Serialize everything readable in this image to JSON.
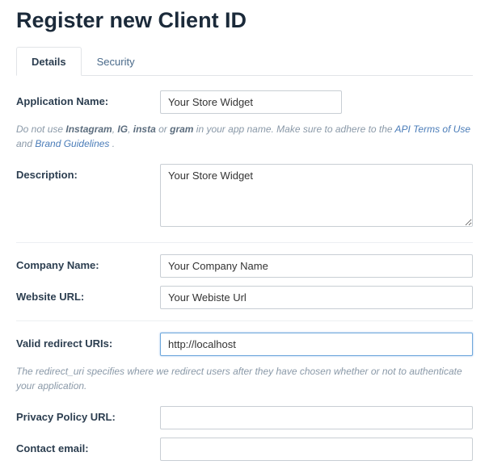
{
  "page": {
    "title": "Register new Client ID"
  },
  "tabs": {
    "details": "Details",
    "security": "Security"
  },
  "form": {
    "appName": {
      "label": "Application Name:",
      "value": "Your Store Widget"
    },
    "appNameHint": {
      "prefix": "Do not use ",
      "kw1": "Instagram",
      "sep1": ", ",
      "kw2": "IG",
      "sep2": ", ",
      "kw3": "insta",
      "sep3": " or ",
      "kw4": "gram",
      "mid": " in your app name. Make sure to adhere to the ",
      "link1": "API Terms of Use",
      "and": " and ",
      "link2": "Brand Guidelines",
      "end": " ."
    },
    "description": {
      "label": "Description:",
      "value": "Your Store Widget"
    },
    "companyName": {
      "label": "Company Name:",
      "value": "Your Company Name"
    },
    "websiteUrl": {
      "label": "Website URL:",
      "value": "Your Webiste Url"
    },
    "redirectUris": {
      "label": "Valid redirect URIs:",
      "value": "http://localhost"
    },
    "redirectHint": "The redirect_uri specifies where we redirect users after they have chosen whether or not to authenticate your application.",
    "privacyPolicy": {
      "label": "Privacy Policy URL:",
      "value": ""
    },
    "contactEmail": {
      "label": "Contact email:",
      "value": ""
    }
  }
}
